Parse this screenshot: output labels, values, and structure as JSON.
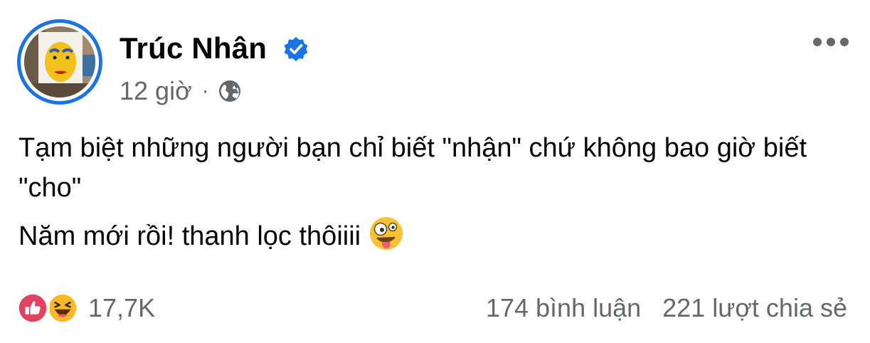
{
  "post": {
    "author": "Trúc Nhân",
    "time": "12 giờ",
    "separator": "·",
    "audience_icon": "globe-icon",
    "verified_icon": "verified-badge-icon",
    "more_icon": "more-options-icon",
    "lines": [
      "Tạm biệt những người bạn chỉ biết \"nhận\" chứ không bao giờ biết \"cho\"",
      "Năm mới rồi! thanh lọc thôiiii"
    ],
    "inline_emoji": "zany-face-emoji"
  },
  "footer": {
    "reaction_icons": [
      "like-reaction-icon",
      "haha-reaction-icon"
    ],
    "reaction_count": "17,7K",
    "comments": "174 bình luận",
    "shares": "221 lượt chia sẻ"
  },
  "colors": {
    "brand_blue": "#1b74e4",
    "text_primary": "#050505",
    "text_secondary": "#65676b",
    "like_red": "#e4405f",
    "haha_yellow": "#f7b928"
  }
}
